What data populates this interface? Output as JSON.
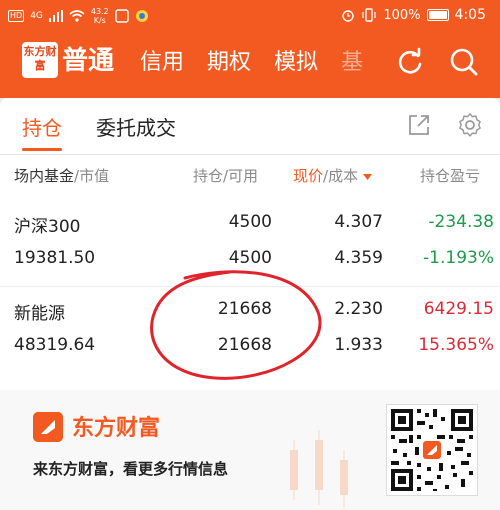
{
  "statusbar": {
    "network_badge": "HD",
    "signal_label": "4G",
    "speed_value": "43.2",
    "speed_unit": "K/s",
    "battery": "100%",
    "time": "4:05"
  },
  "header": {
    "logo_text": "东方财富",
    "tabs": [
      {
        "label": "普通"
      },
      {
        "label": "信用"
      },
      {
        "label": "期权"
      },
      {
        "label": "模拟"
      },
      {
        "label": "基"
      }
    ]
  },
  "subtabs": [
    {
      "label": "持仓"
    },
    {
      "label": "委托成交"
    }
  ],
  "columns": {
    "name": "场内基金",
    "name_sub": "/市值",
    "pos": "持仓/可用",
    "price": "现价",
    "price_sub": "/成本",
    "pnl": "持仓盈亏"
  },
  "holdings": [
    {
      "name": "沪深300",
      "market_value": "19381.50",
      "position": "4500",
      "available": "4500",
      "price": "4.307",
      "cost": "4.359",
      "pnl": "-234.38",
      "pnl_pct": "-1.193%"
    },
    {
      "name": "新能源",
      "market_value": "48319.64",
      "position": "21668",
      "available": "21668",
      "price": "2.230",
      "cost": "1.933",
      "pnl": "6429.15",
      "pnl_pct": "15.365%"
    }
  ],
  "ad": {
    "brand": "东方财富",
    "text": "来东方财富，看更多行情信息"
  },
  "colors": {
    "accent": "#f25a22",
    "positive": "#d92b35",
    "negative": "#1d9a4a",
    "annotation": "#e0242c"
  },
  "icons": [
    "refresh-icon",
    "search-icon",
    "share-icon",
    "settings-gear-icon",
    "wifi-icon",
    "alarm-icon",
    "vibrate-icon"
  ]
}
